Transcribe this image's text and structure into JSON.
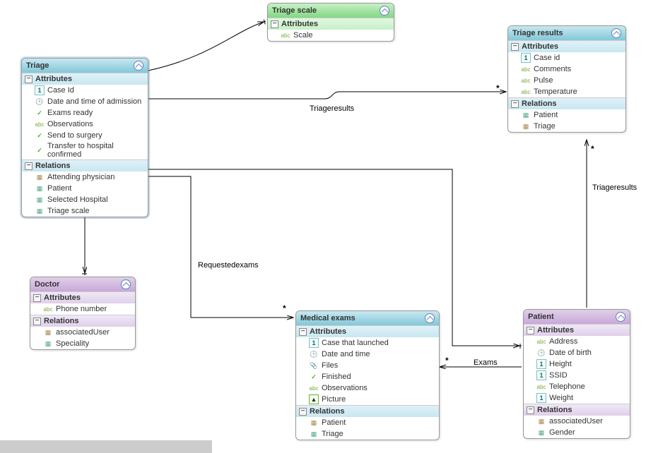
{
  "entities": {
    "triage": {
      "title": "Triage",
      "sections": {
        "attributes": {
          "label": "Attributes",
          "items": [
            {
              "icon": "num",
              "label": "Case Id"
            },
            {
              "icon": "date",
              "label": "Date and time of admission"
            },
            {
              "icon": "check",
              "label": "Exams ready"
            },
            {
              "icon": "abc",
              "label": "Observations"
            },
            {
              "icon": "check",
              "label": "Send to surgery"
            },
            {
              "icon": "check",
              "label": "Transfer to hospital confirmed"
            }
          ]
        },
        "relations": {
          "label": "Relations",
          "items": [
            {
              "icon": "rel",
              "label": "Attending physician"
            },
            {
              "icon": "rel2",
              "label": "Patient"
            },
            {
              "icon": "rel2",
              "label": "Selected Hospital"
            },
            {
              "icon": "rel2",
              "label": "Triage scale"
            }
          ]
        }
      }
    },
    "triage_scale": {
      "title": "Triage scale",
      "sections": {
        "attributes": {
          "label": "Attributes",
          "items": [
            {
              "icon": "abc",
              "label": "Scale"
            }
          ]
        }
      }
    },
    "triage_results": {
      "title": "Triage results",
      "sections": {
        "attributes": {
          "label": "Attributes",
          "items": [
            {
              "icon": "num",
              "label": "Case id"
            },
            {
              "icon": "abc",
              "label": "Comments"
            },
            {
              "icon": "abc",
              "label": "Pulse"
            },
            {
              "icon": "abc",
              "label": "Temperature"
            }
          ]
        },
        "relations": {
          "label": "Relations",
          "items": [
            {
              "icon": "rel2",
              "label": "Patient"
            },
            {
              "icon": "rel",
              "label": "Triage"
            }
          ]
        }
      }
    },
    "doctor": {
      "title": "Doctor",
      "sections": {
        "attributes": {
          "label": "Attributes",
          "items": [
            {
              "icon": "abc",
              "label": "Phone number"
            }
          ]
        },
        "relations": {
          "label": "Relations",
          "items": [
            {
              "icon": "rel",
              "label": "associatedUser"
            },
            {
              "icon": "rel2",
              "label": "Speciality"
            }
          ]
        }
      }
    },
    "medical_exams": {
      "title": "Medical exams",
      "sections": {
        "attributes": {
          "label": "Attributes",
          "items": [
            {
              "icon": "num",
              "label": "Case that launched"
            },
            {
              "icon": "date",
              "label": "Date and time"
            },
            {
              "icon": "file",
              "label": "Files"
            },
            {
              "icon": "check",
              "label": "Finished"
            },
            {
              "icon": "abc",
              "label": "Observations"
            },
            {
              "icon": "pic",
              "label": "Picture"
            }
          ]
        },
        "relations": {
          "label": "Relations",
          "items": [
            {
              "icon": "rel",
              "label": "Patient"
            },
            {
              "icon": "rel2",
              "label": "Triage"
            }
          ]
        }
      }
    },
    "patient": {
      "title": "Patient",
      "sections": {
        "attributes": {
          "label": "Attributes",
          "items": [
            {
              "icon": "abc",
              "label": "Address"
            },
            {
              "icon": "date",
              "label": "Date of birth"
            },
            {
              "icon": "num",
              "label": "Height"
            },
            {
              "icon": "num",
              "label": "SSID"
            },
            {
              "icon": "abc",
              "label": "Telephone"
            },
            {
              "icon": "num",
              "label": "Weight"
            }
          ]
        },
        "relations": {
          "label": "Relations",
          "items": [
            {
              "icon": "rel",
              "label": "associatedUser"
            },
            {
              "icon": "rel2",
              "label": "Gender"
            }
          ]
        }
      }
    }
  },
  "edges": {
    "triageresults1": "Triageresults",
    "requestedexams": "Requestedexams",
    "exams": "Exams",
    "triageresults2": "Triageresults"
  },
  "multiplicity": "*"
}
